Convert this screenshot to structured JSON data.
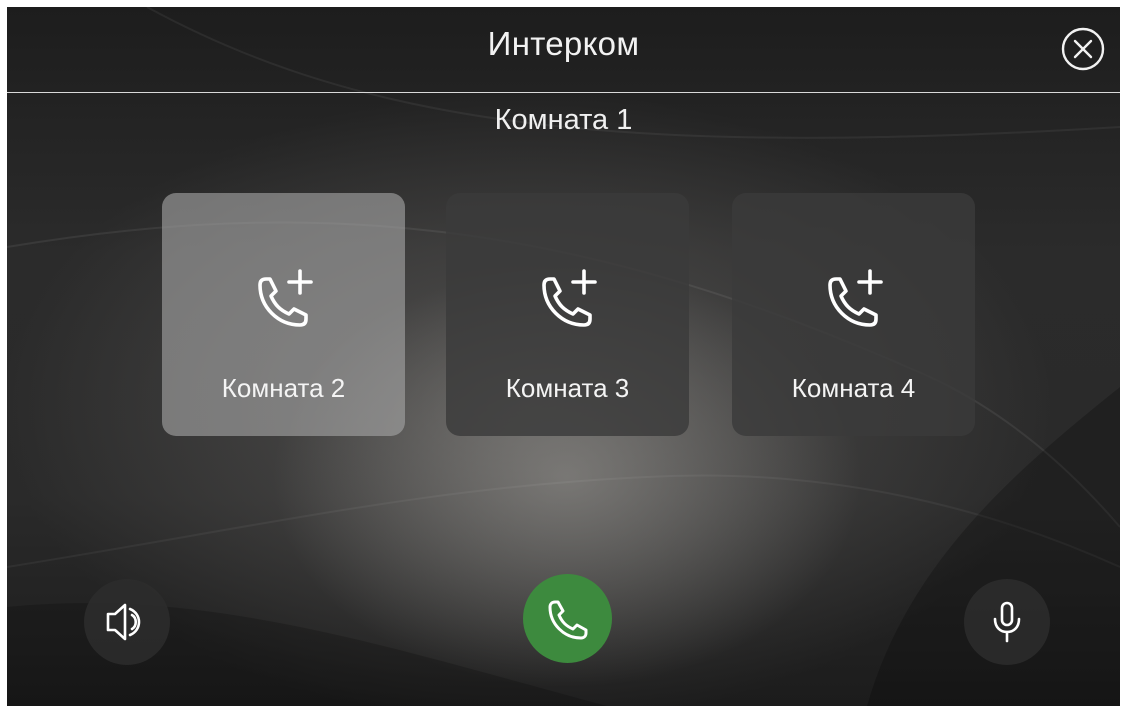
{
  "header": {
    "title": "Интерком",
    "close_icon": "close-circle-icon"
  },
  "current_room": "Комната 1",
  "rooms": [
    {
      "label": "Комната 2",
      "icon": "phone-add-icon",
      "selected": true
    },
    {
      "label": "Комната 3",
      "icon": "phone-add-icon",
      "selected": false
    },
    {
      "label": "Комната 4",
      "icon": "phone-add-icon",
      "selected": false
    }
  ],
  "controls": {
    "speaker_icon": "speaker-icon",
    "call_icon": "phone-icon",
    "mic_icon": "microphone-icon"
  },
  "colors": {
    "accent_call": "#3d8a3e",
    "selected_tile": "#a5a5a5",
    "tile": "#3a3a3a",
    "text": "#f2f2f2"
  }
}
